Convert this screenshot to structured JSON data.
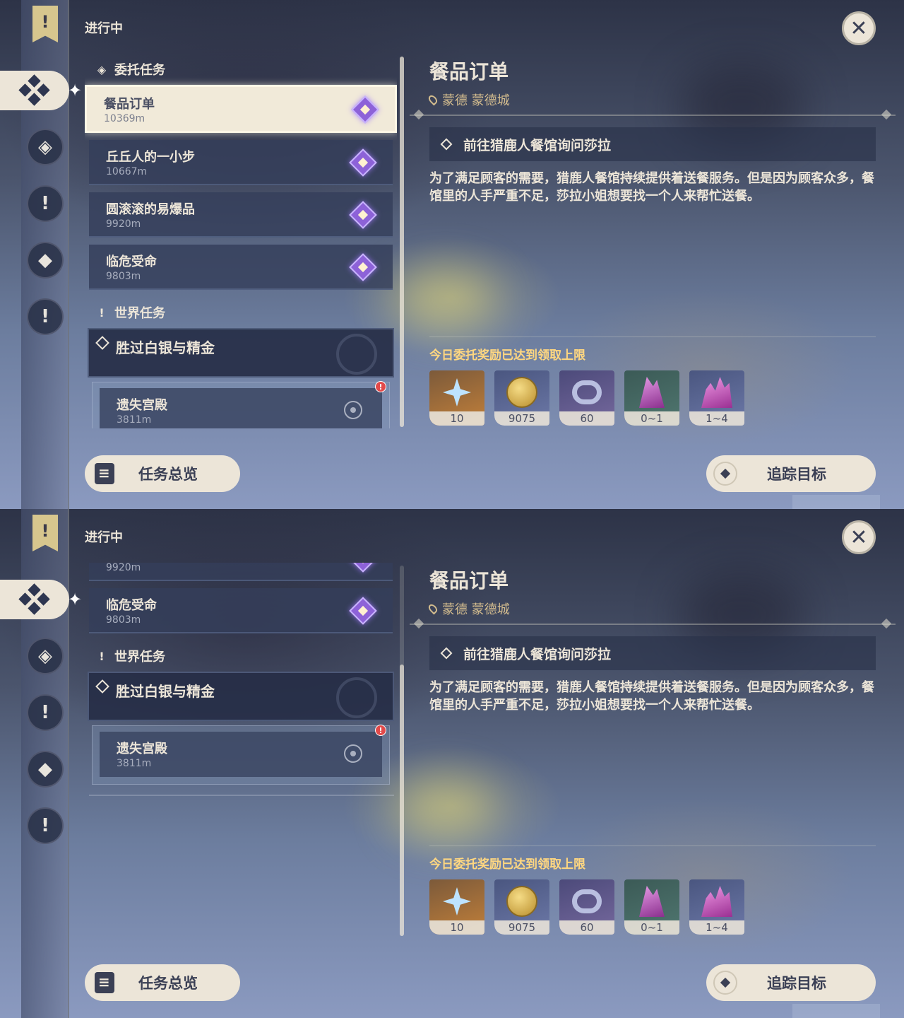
{
  "ui": {
    "section_title": "进行中",
    "close_icon": "close-icon",
    "categories": {
      "commission": "委托任务",
      "world": "世界任务"
    },
    "quests": [
      {
        "name": "餐品订单",
        "distance": "10369m"
      },
      {
        "name": "丘丘人的一小步",
        "distance": "10667m"
      },
      {
        "name": "圆滚滚的易爆品",
        "distance": "9920m"
      },
      {
        "name": "临危受命",
        "distance": "9803m"
      }
    ],
    "world_quest": {
      "name": "胜过白银与精金",
      "sub_name": "遗失宫殿",
      "sub_distance": "3811m",
      "alert": "!"
    },
    "detail": {
      "title": "餐品订单",
      "location": "蒙德 蒙德城",
      "objective": "前往猎鹿人餐馆询问莎拉",
      "description": "为了满足顾客的需要，猎鹿人餐馆持续提供着送餐服务。但是因为顾客众多，餐馆里的人手严重不足，莎拉小姐想要找一个人来帮忙送餐。",
      "reward_note": "今日委托奖励已达到领取上限",
      "rewards": [
        {
          "label": "10",
          "icon": "primogem-icon"
        },
        {
          "label": "9075",
          "icon": "mora-icon"
        },
        {
          "label": "60",
          "icon": "friendship-icon"
        },
        {
          "label": "0~1",
          "icon": "crystal-icon"
        },
        {
          "label": "1~4",
          "icon": "crystal-cluster-icon"
        }
      ]
    },
    "buttons": {
      "overview": "任务总览",
      "track": "追踪目标"
    },
    "rail_icons": [
      "quest-banner-icon",
      "commission-icon",
      "archon-quest-icon",
      "world-quest-icon",
      "event-quest-icon",
      "alert-quest-icon"
    ],
    "scroll": {
      "top_position": 0.0,
      "bottom_position": 1.0
    }
  }
}
